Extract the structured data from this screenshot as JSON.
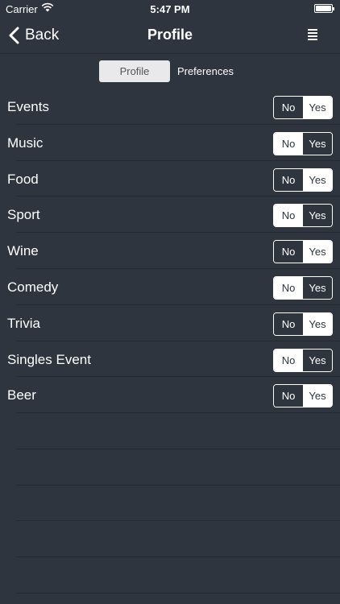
{
  "status_bar": {
    "carrier": "Carrier",
    "time": "5:47 PM"
  },
  "nav": {
    "back_label": "Back",
    "title": "Profile"
  },
  "tabs": [
    {
      "label": "Profile",
      "active": true
    },
    {
      "label": "Preferences",
      "active": false
    }
  ],
  "rows": [
    {
      "label": "Events",
      "no": "No",
      "yes": "Yes",
      "selected": "no"
    },
    {
      "label": "Music",
      "no": "No",
      "yes": "Yes",
      "selected": "yes"
    },
    {
      "label": "Food",
      "no": "No",
      "yes": "Yes",
      "selected": "no"
    },
    {
      "label": "Sport",
      "no": "No",
      "yes": "Yes",
      "selected": "yes"
    },
    {
      "label": "Wine",
      "no": "No",
      "yes": "Yes",
      "selected": "no"
    },
    {
      "label": "Comedy",
      "no": "No",
      "yes": "Yes",
      "selected": "yes"
    },
    {
      "label": "Trivia",
      "no": "No",
      "yes": "Yes",
      "selected": "no"
    },
    {
      "label": "Singles Event",
      "no": "No",
      "yes": "Yes",
      "selected": "yes"
    },
    {
      "label": "Beer",
      "no": "No",
      "yes": "Yes",
      "selected": "no"
    }
  ],
  "colors": {
    "background": "#2f353f",
    "separator": "#262b33",
    "segment_active": "#e9e9eb"
  },
  "icons": {
    "back": "chevron-left-icon",
    "menu": "menu-icon",
    "wifi": "wifi-icon",
    "battery": "battery-icon"
  }
}
